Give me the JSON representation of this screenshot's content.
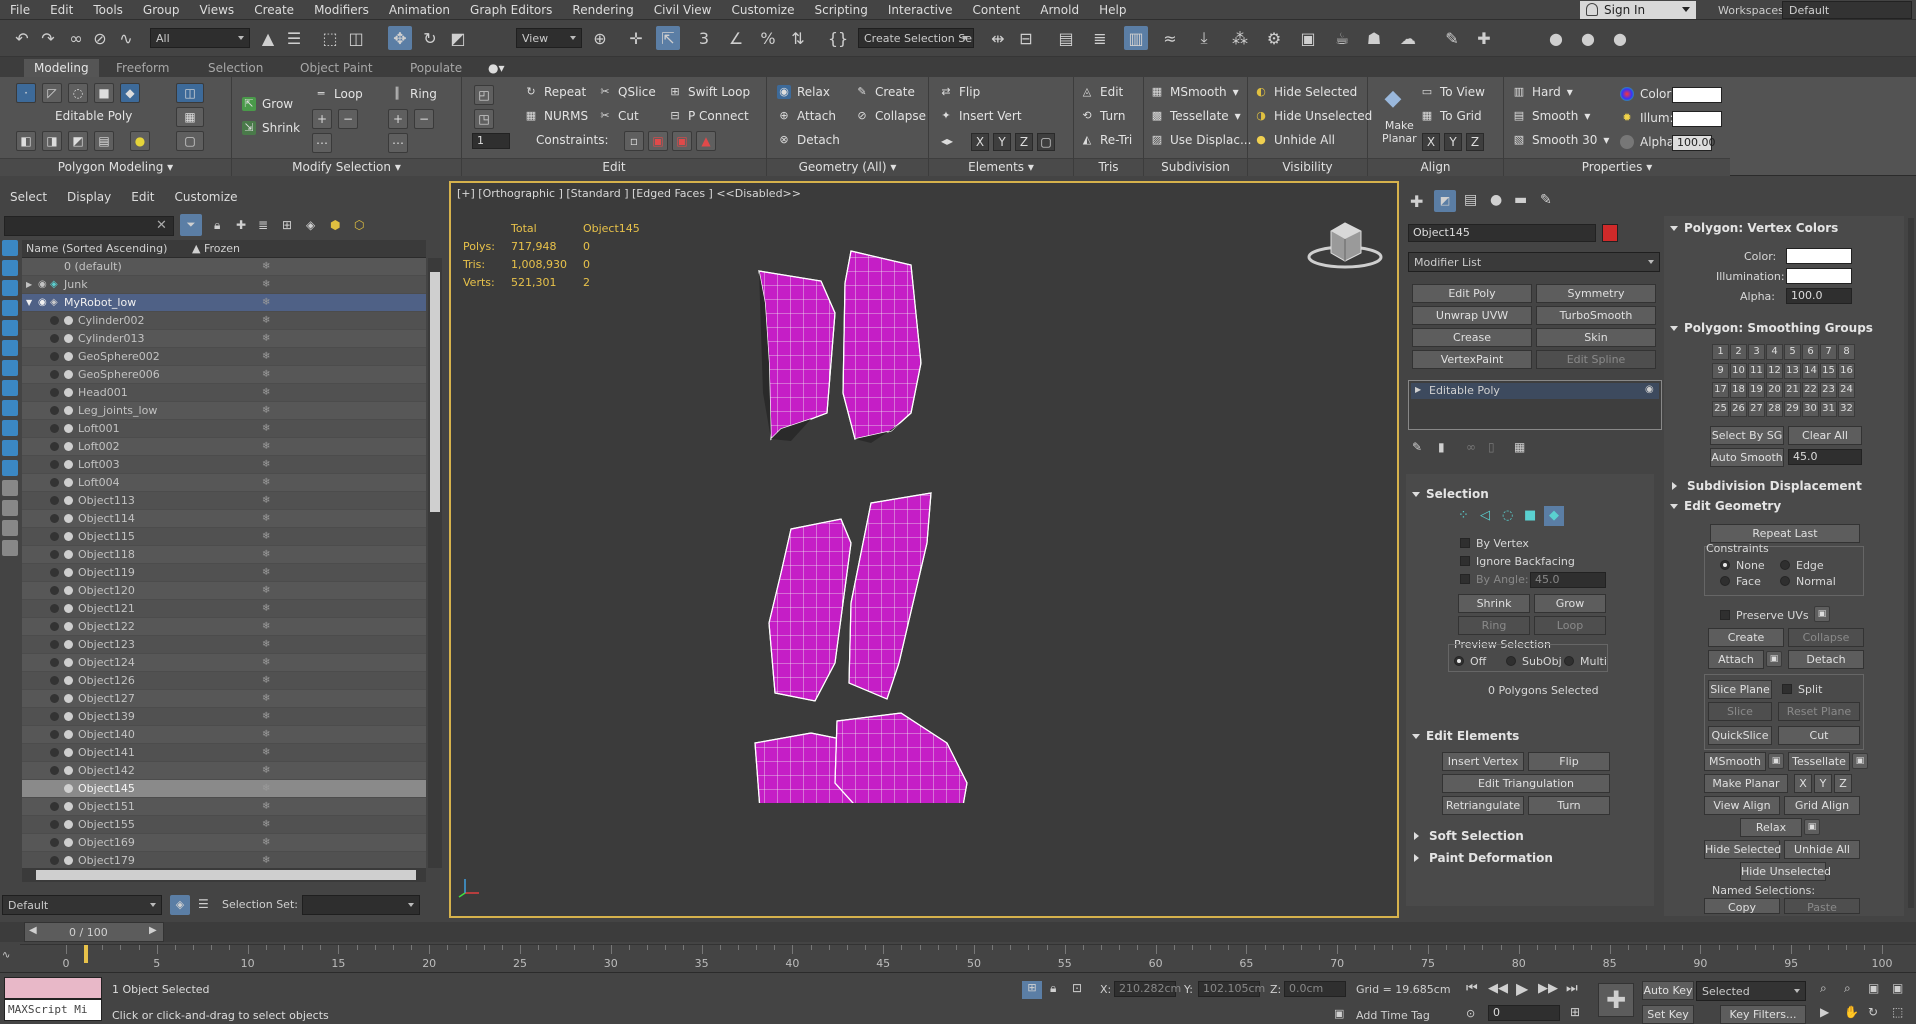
{
  "menu": [
    "File",
    "Edit",
    "Tools",
    "Group",
    "Views",
    "Create",
    "Modifiers",
    "Animation",
    "Graph Editors",
    "Rendering",
    "Civil View",
    "Customize",
    "Scripting",
    "Interactive",
    "Content",
    "Arnold",
    "Help"
  ],
  "signin": "Sign In",
  "workspaces_label": "Workspaces:",
  "workspaces_value": "Default",
  "toolbar": {
    "filter": "All",
    "refcoord": "View",
    "selset": "Create Selection Se"
  },
  "ribbon_tabs": [
    "Modeling",
    "Freeform",
    "Selection",
    "Object Paint",
    "Populate"
  ],
  "ribbon": {
    "editable_poly": "Editable Poly",
    "polygon_modeling": "Polygon Modeling",
    "grow": "Grow",
    "shrink": "Shrink",
    "loop": "Loop",
    "ring": "Ring",
    "modify_selection": "Modify Selection",
    "repeat": "Repeat",
    "qslice": "QSlice",
    "swift_loop": "Swift Loop",
    "nurms": "NURMS",
    "cut": "Cut",
    "p_connect": "P Connect",
    "constraints": "Constraints:",
    "spin_value": "1",
    "edit": "Edit",
    "relax": "Relax",
    "create": "Create",
    "attach": "Attach",
    "collapse": "Collapse",
    "detach": "Detach",
    "geometry_all": "Geometry (All)",
    "flip": "Flip",
    "insert_vert": "Insert Vert",
    "elements": "Elements",
    "tris_edit": "Edit",
    "turn": "Turn",
    "retri": "Re-Tri",
    "tris": "Tris",
    "msmooth": "MSmooth",
    "tessellate": "Tessellate",
    "use_displac": "Use Displac...",
    "subdivision": "Subdivision",
    "hide_selected": "Hide Selected",
    "hide_unselected": "Hide Unselected",
    "unhide_all": "Unhide All",
    "visibility": "Visibility",
    "make_planar": "Make Planar",
    "to_view": "To View",
    "to_grid": "To Grid",
    "align": "Align",
    "hard": "Hard",
    "smooth": "Smooth",
    "smooth30": "Smooth 30",
    "color": "Color:",
    "illum": "Illum:",
    "alpha": "Alpha:",
    "alpha_value": "100.00",
    "properties": "Properties",
    "x": "X",
    "y": "Y",
    "z": "Z"
  },
  "scene_explorer": {
    "menu": [
      "Select",
      "Display",
      "Edit",
      "Customize"
    ],
    "col_name": "Name (Sorted Ascending)",
    "col_frozen": "▲ Frozen",
    "rows": [
      "0 (default)",
      "Junk",
      "MyRobot_low",
      "Cylinder002",
      "Cylinder013",
      "GeoSphere002",
      "GeoSphere006",
      "Head001",
      "Leg_joints_low",
      "Loft001",
      "Loft002",
      "Loft003",
      "Loft004",
      "Object113",
      "Object114",
      "Object115",
      "Object118",
      "Object119",
      "Object120",
      "Object121",
      "Object122",
      "Object123",
      "Object124",
      "Object126",
      "Object127",
      "Object139",
      "Object140",
      "Object141",
      "Object142",
      "Object145",
      "Object151",
      "Object155",
      "Object169",
      "Object179"
    ]
  },
  "layer": {
    "name": "Default",
    "selection_set": "Selection Set:"
  },
  "viewport": {
    "label": "[+] [Orthographic ] [Standard ] [Edged Faces ]  <<Disabled>>",
    "stats": {
      "col1": "Total",
      "col2": "Object145",
      "rows": [
        {
          "label": "Polys:",
          "total": "717,948",
          "obj": "0"
        },
        {
          "label": "Tris:",
          "total": "1,008,930",
          "obj": "0"
        },
        {
          "label": "Verts:",
          "total": "521,301",
          "obj": "2"
        }
      ]
    }
  },
  "command_panel": {
    "object_name": "Object145",
    "modifier_list": "Modifier List",
    "buttons": [
      "Edit Poly",
      "Symmetry",
      "Unwrap UVW",
      "TurboSmooth",
      "Crease",
      "Skin",
      "VertexPaint",
      "Edit Spline"
    ],
    "stack_item": "Editable Poly",
    "selection": "Selection",
    "by_vertex": "By Vertex",
    "ignore_backfacing": "Ignore Backfacing",
    "by_angle": "By Angle:",
    "by_angle_value": "45.0",
    "shrink": "Shrink",
    "grow": "Grow",
    "ring": "Ring",
    "loop": "Loop",
    "preview_selection": "Preview Selection",
    "off": "Off",
    "subobj": "SubObj",
    "multi": "Multi",
    "polygons_selected": "0 Polygons Selected",
    "edit_elements": "Edit Elements",
    "insert_vertex": "Insert Vertex",
    "flip": "Flip",
    "edit_triangulation": "Edit Triangulation",
    "retriangulate": "Retriangulate",
    "turn": "Turn",
    "soft_selection": "Soft Selection",
    "paint_deformation": "Paint Deformation",
    "vertex_colors": "Polygon: Vertex Colors",
    "color": "Color:",
    "illumination": "Illumination:",
    "alpha": "Alpha:",
    "alpha_value": "100.0",
    "smoothing_groups": "Polygon: Smoothing Groups",
    "sg_numbers": [
      "1",
      "2",
      "3",
      "4",
      "5",
      "6",
      "7",
      "8",
      "9",
      "10",
      "11",
      "12",
      "13",
      "14",
      "15",
      "16",
      "17",
      "18",
      "19",
      "20",
      "21",
      "22",
      "23",
      "24",
      "25",
      "26",
      "27",
      "28",
      "29",
      "30",
      "31",
      "32"
    ],
    "select_by_sg": "Select By SG",
    "clear_all": "Clear All",
    "auto_smooth": "Auto Smooth",
    "auto_smooth_value": "45.0",
    "subdivision_displacement": "Subdivision Displacement",
    "edit_geometry": "Edit Geometry",
    "repeat_last": "Repeat Last",
    "constraints": "Constraints",
    "none": "None",
    "edge": "Edge",
    "face": "Face",
    "normal": "Normal",
    "preserve_uvs": "Preserve UVs",
    "create": "Create",
    "collapse": "Collapse",
    "attach": "Attach",
    "detach": "Detach",
    "slice_plane": "Slice Plane",
    "split": "Split",
    "slice": "Slice",
    "reset_plane": "Reset Plane",
    "quickslice": "QuickSlice",
    "cut": "Cut",
    "msmooth": "MSmooth",
    "tessellate": "Tessellate",
    "make_planar": "Make Planar",
    "x": "X",
    "y": "Y",
    "z": "Z",
    "view_align": "View Align",
    "grid_align": "Grid Align",
    "relax": "Relax",
    "hide_selected": "Hide Selected",
    "unhide_all": "Unhide All",
    "hide_unselected": "Hide Unselected",
    "named_selections": "Named Selections:",
    "copy": "Copy",
    "paste": "Paste"
  },
  "timeline": {
    "frame": "0 / 100",
    "ticks": [
      "0",
      "5",
      "10",
      "15",
      "20",
      "25",
      "30",
      "35",
      "40",
      "45",
      "50",
      "55",
      "60",
      "65",
      "70",
      "75",
      "80",
      "85",
      "90",
      "95",
      "100"
    ]
  },
  "status": {
    "maxscript": "MAXScript Mi",
    "objects_selected": "1 Object Selected",
    "prompt": "Click or click-and-drag to select objects",
    "x_label": "X:",
    "x_value": "210.282cm",
    "y_label": "Y:",
    "y_value": "102.105cm",
    "z_label": "Z:",
    "z_value": "0.0cm",
    "grid": "Grid = 19.685cm",
    "add_time_tag": "Add Time Tag",
    "auto_key": "Auto Key",
    "set_key": "Set Key",
    "selected": "Selected",
    "key_filters": "Key Filters...",
    "frame_value": "0"
  },
  "colors": {
    "accent": "#5b7ea5",
    "mesh": "#c51ec6",
    "viewport_border": "#d6b24c",
    "object_color": "#d02a2a"
  }
}
